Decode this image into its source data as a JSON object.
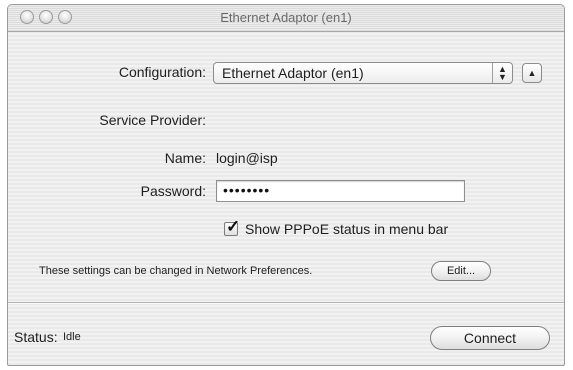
{
  "window": {
    "title": "Ethernet Adaptor (en1)"
  },
  "configuration": {
    "label": "Configuration:",
    "selected": "Ethernet Adaptor (en1)",
    "arrows_icon": "updown-arrows-icon",
    "toggle_icon": "triangle-up-icon"
  },
  "service_provider": {
    "label": "Service Provider:"
  },
  "name": {
    "label": "Name:",
    "value": "login@isp"
  },
  "password": {
    "label": "Password:",
    "value": "••••••••"
  },
  "show_status": {
    "checked": true,
    "label": "Show PPPoE status in menu bar"
  },
  "note": {
    "text": "These settings can be changed in Network Preferences.",
    "edit_label": "Edit..."
  },
  "status": {
    "label": "Status:",
    "value": "Idle"
  },
  "connect_label": "Connect",
  "colors": {
    "window_border": "#9a9a9a",
    "stripe_light": "#f2f2f2",
    "stripe_dark": "#e9e9e9"
  }
}
